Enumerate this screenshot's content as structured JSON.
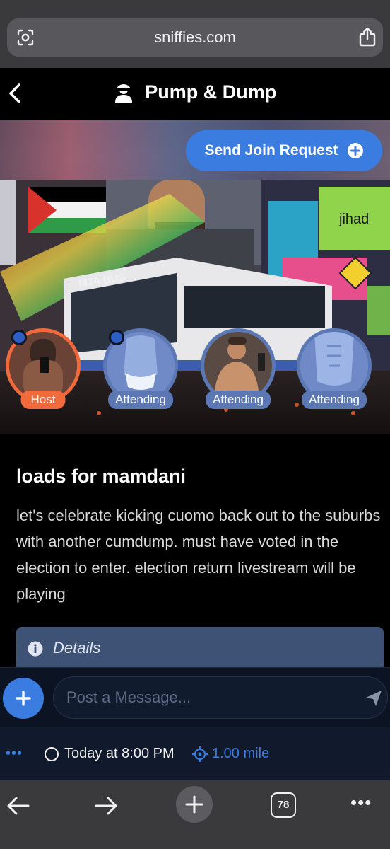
{
  "browser": {
    "url": "sniffies.com",
    "bottom": {
      "tab_count": "78",
      "more_label": "•••"
    }
  },
  "header": {
    "title": "Pump & Dump"
  },
  "hero": {
    "join_button_label": "Send Join Request",
    "scene_texts": {
      "bus_label": "MTA BUS",
      "billboard_word": "jihad"
    },
    "avatars": [
      {
        "role": "Host"
      },
      {
        "role": "Attending"
      },
      {
        "role": "Attending"
      },
      {
        "role": "Attending"
      }
    ]
  },
  "event": {
    "title": "loads for mamdani",
    "description": "let's celebrate kicking cuomo back out to the suburbs with another cumdump. must have voted in the election to enter. election return livestream will be playing",
    "details_label": "Details"
  },
  "composer": {
    "placeholder": "Post a Message..."
  },
  "info_bar": {
    "more_label": "•••",
    "time": "Today at 8:00 PM",
    "distance": "1.00 mile"
  },
  "colors": {
    "accent_blue": "#3b7ce0",
    "host_orange": "#f06a3c",
    "attending_blue": "#5b78b5",
    "details_card": "#3d5275"
  },
  "icons": {
    "url_left": "page-settings-icon",
    "url_right": "share-icon",
    "header": "user-incognito-icon",
    "join": "plus-circle-icon",
    "details": "info-circle-icon",
    "composer_left": "plus-icon",
    "composer_right": "send-icon",
    "time": "clock-icon",
    "distance": "crosshair-icon",
    "nav_back": "back-arrow-icon",
    "nav_forward": "forward-arrow-icon",
    "new_tab": "plus-icon"
  }
}
